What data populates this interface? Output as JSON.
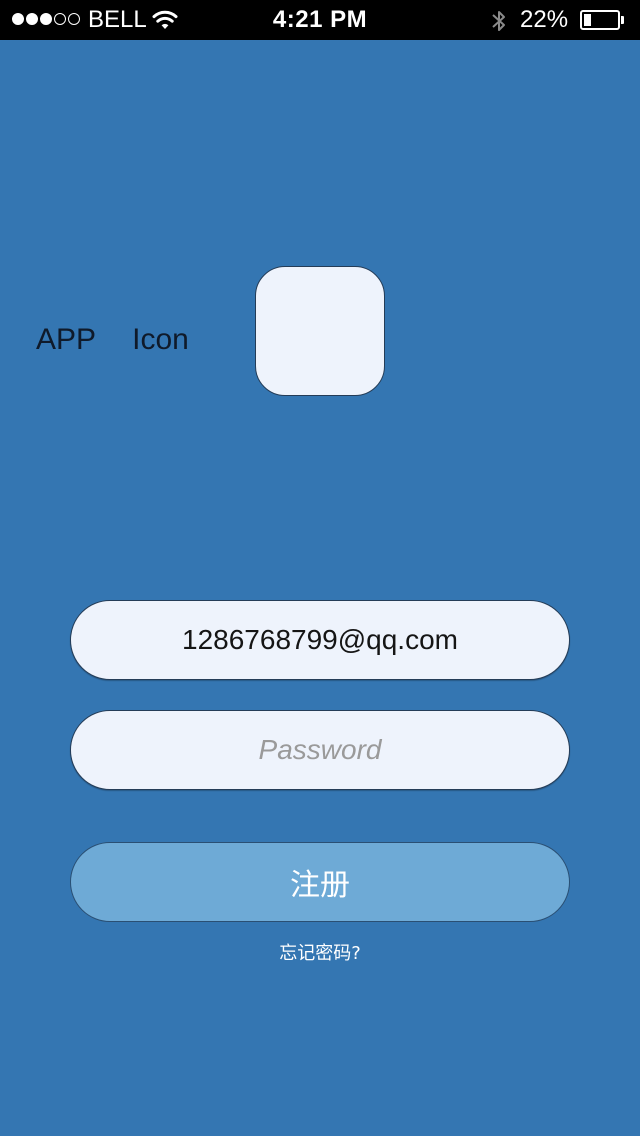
{
  "status_bar": {
    "signal_bars_filled": 3,
    "signal_bars_total": 5,
    "carrier": "BELL",
    "time": "4:21 PM",
    "battery_percent_label": "22%",
    "battery_level": 0.22,
    "icons": [
      "wifi-icon",
      "bluetooth-icon",
      "battery-icon"
    ]
  },
  "login": {
    "app_icon_label": "APP  Icon",
    "email_value": "1286768799@qq.com",
    "password_placeholder": "Password",
    "register_button_label": "注册",
    "forgot_password_link": "忘记密码?"
  },
  "colors": {
    "background": "#3476b2",
    "field_background": "#eef3fc",
    "button_background": "#6eaad6",
    "status_bar": "#000000"
  }
}
